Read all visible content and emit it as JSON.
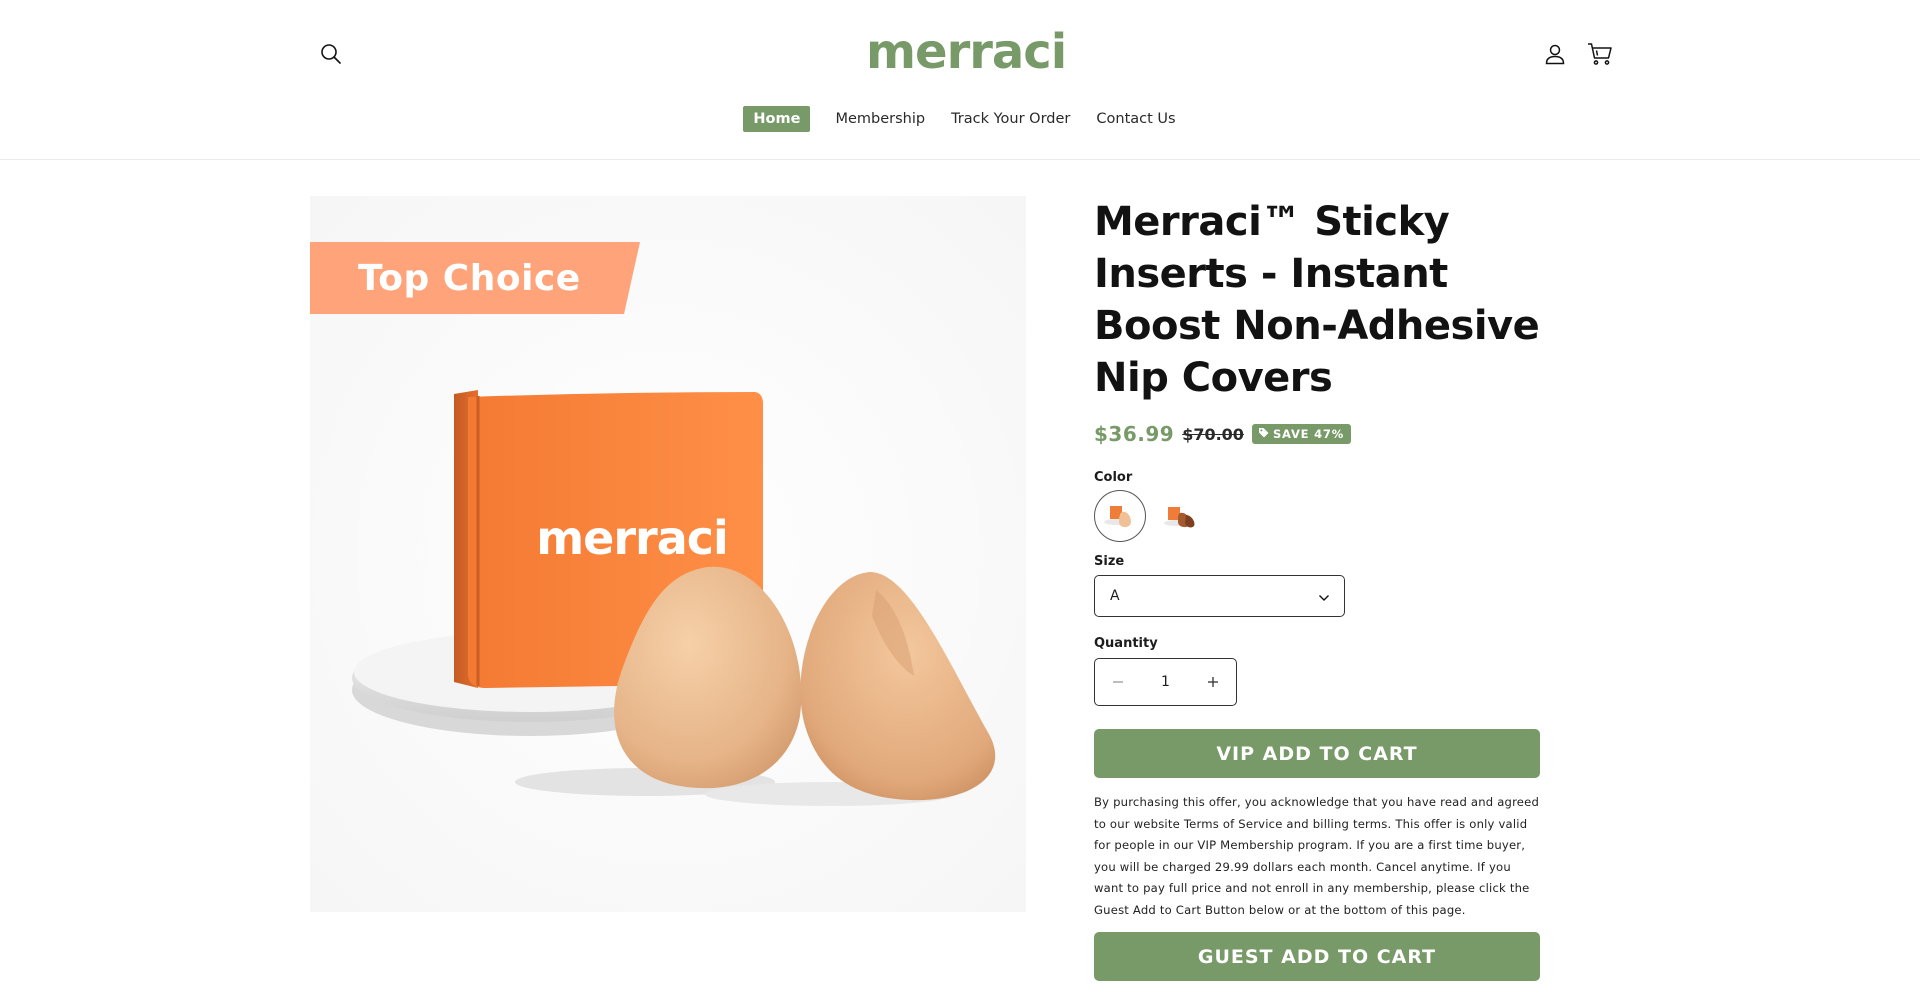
{
  "header": {
    "logo": "merraci",
    "search_icon": "search-icon",
    "account_icon": "user-icon",
    "cart_icon": "cart-icon"
  },
  "nav": {
    "items": [
      {
        "label": "Home",
        "active": true
      },
      {
        "label": "Membership",
        "active": false
      },
      {
        "label": "Track Your Order",
        "active": false
      },
      {
        "label": "Contact Us",
        "active": false
      }
    ]
  },
  "media": {
    "badge": "Top Choice",
    "box_brand": "merraci"
  },
  "product": {
    "title": "Merraci™ Sticky Inserts - Instant Boost Non-Adhesive Nip Covers",
    "price_sale": "$36.99",
    "price_regular": "$70.00",
    "save_badge": "SAVE 47%",
    "color_label": "Color",
    "size_label": "Size",
    "size_value": "A",
    "quantity_label": "Quantity",
    "quantity_value": "1",
    "vip_button": "VIP ADD TO CART",
    "disclaimer": "By purchasing this offer, you acknowledge that you have read and agreed to our website Terms of Service and billing terms. This offer is only valid for people in our VIP Membership program. If you are a first time buyer, you will be charged 29.99 dollars each month. Cancel anytime. If you want to pay full price and not enroll in any membership, please click the Guest Add to Cart Button below or at the bottom of this page.",
    "guest_button": "GUEST ADD TO CART"
  },
  "colors": {
    "accent": "#789a68",
    "badge_orange": "#ffa47a",
    "box_orange": "#f07c3a"
  }
}
